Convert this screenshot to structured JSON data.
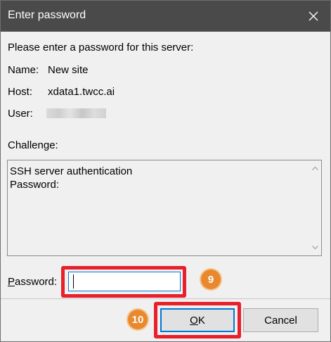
{
  "window": {
    "title": "Enter password",
    "close_icon": "close-icon"
  },
  "prompt": "Please enter a password for this server:",
  "details": {
    "name_label": "Name:",
    "name_value": "New site",
    "host_label": "Host:",
    "host_value": "xdata1.twcc.ai",
    "user_label": "User:"
  },
  "challenge": {
    "label": "Challenge:",
    "text": "SSH server authentication\nPassword:"
  },
  "password": {
    "label_prefix": "P",
    "label_rest": "assword:",
    "value": ""
  },
  "annotations": {
    "step_password": "9",
    "step_ok": "10",
    "highlight_color": "#e8202b",
    "badge_color": "#e8892d"
  },
  "buttons": {
    "ok_prefix": "O",
    "ok_rest": "K",
    "cancel": "Cancel"
  }
}
